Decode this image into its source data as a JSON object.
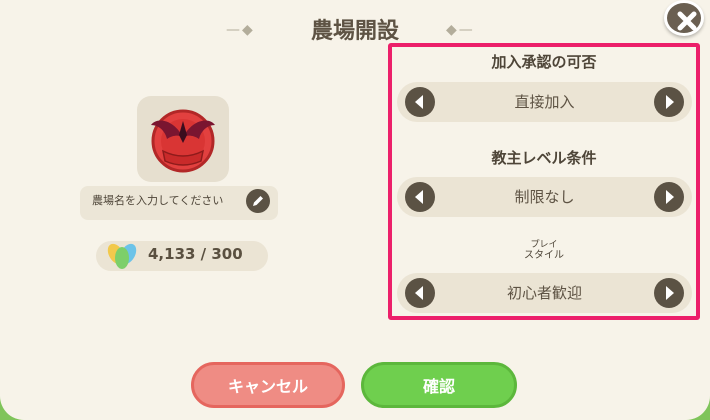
{
  "dialog": {
    "title": "農場開設",
    "title_deco_left": "—◆",
    "title_deco_right": "◆—",
    "close_icon": "close-icon"
  },
  "farm": {
    "name_placeholder": "農場名を入力してください",
    "emblem_icon": "farm-emblem-icon",
    "edit_icon": "pencil-icon",
    "currency_icon": "leaf-currency-icon",
    "cost": "4,133 / 300"
  },
  "options": [
    {
      "label": "加入承認の可否",
      "value": "直接加入"
    },
    {
      "label": "教主レベル条件",
      "value": "制限なし"
    },
    {
      "label": "スタイル",
      "ruby": "プレイ",
      "value": "初心者歓迎"
    }
  ],
  "buttons": {
    "cancel": "キャンセル",
    "confirm": "確認"
  },
  "colors": {
    "highlight": "#ec1f6a",
    "cancel": "#ef8c84",
    "confirm": "#6fcf4e",
    "panel": "#f7f3e9"
  }
}
